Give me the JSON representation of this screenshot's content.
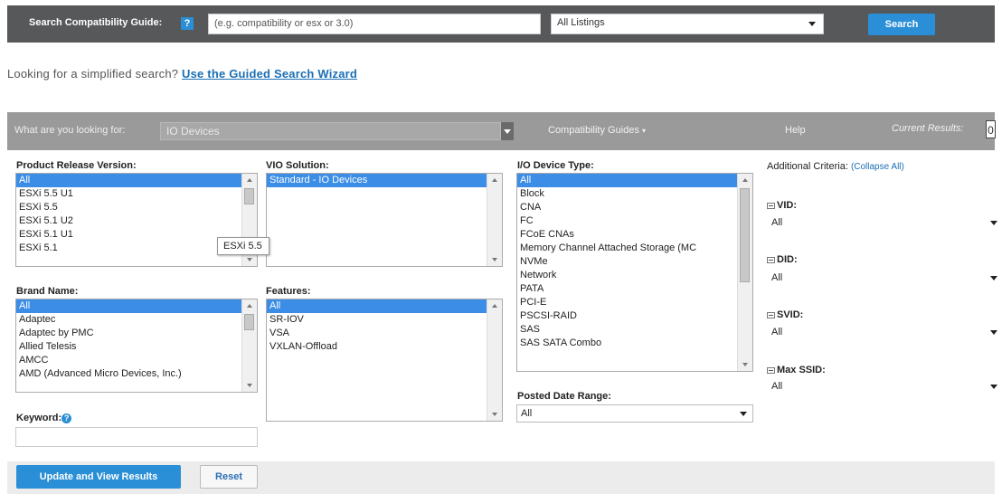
{
  "top_bar": {
    "label": "Search Compatibility Guide:",
    "help_icon_text": "?",
    "query_placeholder": "(e.g. compatibility or esx or 3.0)",
    "listing_select": "All Listings",
    "search_button": "Search"
  },
  "guided": {
    "prefix": "Looking for a simplified search?",
    "link": "Use the Guided Search Wizard"
  },
  "filter_bar": {
    "label": "What are you looking for:",
    "device_select": "IO Devices",
    "compat_guides": "Compatibility Guides",
    "help": "Help",
    "current_results_label": "Current Results:",
    "current_results_value": "0"
  },
  "product_release": {
    "label": "Product Release Version:",
    "options": [
      "All",
      "ESXi 5.5 U1",
      "ESXi 5.5",
      "ESXi 5.1 U2",
      "ESXi 5.1 U1",
      "ESXi 5.1"
    ],
    "tooltip": "ESXi 5.5"
  },
  "vio_solution": {
    "label": "VIO Solution:",
    "options": [
      "Standard - IO Devices"
    ]
  },
  "io_device_type": {
    "label": "I/O Device Type:",
    "options": [
      "All",
      "Block",
      "CNA",
      "FC",
      "FCoE CNAs",
      "Memory Channel Attached Storage (MC",
      "NVMe",
      "Network",
      "PATA",
      "PCI-E",
      "PSCSI-RAID",
      "SAS",
      "SAS SATA Combo"
    ]
  },
  "brand_name": {
    "label": "Brand Name:",
    "options": [
      "All",
      "Adaptec",
      "Adaptec by PMC",
      "Allied Telesis",
      "AMCC",
      "AMD (Advanced Micro Devices, Inc.)"
    ]
  },
  "features": {
    "label": "Features:",
    "options": [
      "All",
      "SR-IOV",
      "VSA",
      "VXLAN-Offload"
    ]
  },
  "keyword": {
    "label": "Keyword:",
    "value": ""
  },
  "posted_date": {
    "label": "Posted Date Range:",
    "value": "All"
  },
  "additional": {
    "label": "Additional Criteria:",
    "collapse_link": "(Collapse All)",
    "vid": {
      "label": "VID:",
      "value": "All"
    },
    "did": {
      "label": "DID:",
      "value": "All"
    },
    "svid": {
      "label": "SVID:",
      "value": "All"
    },
    "max_ssid": {
      "label": "Max SSID:",
      "value": "All"
    }
  },
  "bottom_bar": {
    "update_button": "Update and View Results",
    "reset_button": "Reset"
  },
  "colors": {
    "accent_blue": "#2a8fd6",
    "selection_blue": "#3b8de6",
    "top_bar_bg": "#57585a",
    "filter_bar_bg": "#9a9a9a"
  }
}
